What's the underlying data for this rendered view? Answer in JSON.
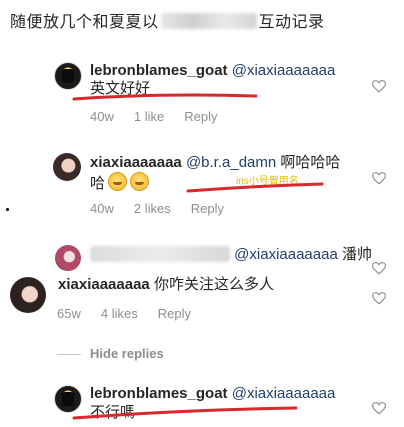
{
  "header": {
    "before": "随便放几个和夏夏以",
    "after": "互动记录"
  },
  "comments": [
    {
      "username": "lebronblames_goat",
      "mention": "@xiaxiaaaaaaa",
      "text": "英文好好",
      "time": "40w",
      "likes": "1 like",
      "reply": "Reply"
    },
    {
      "username": "xiaxiaaaaaaa",
      "mention": "@b.r.a_damn",
      "text": "啊哈哈哈",
      "text2": "哈",
      "annotation": "ins小号曾用名",
      "time": "40w",
      "likes": "2 likes",
      "reply": "Reply"
    },
    {
      "mention": "@xiaxiaaaaaaa",
      "text": "潘帅"
    },
    {
      "username": "xiaxiaaaaaaa",
      "text": "你咋关注这么多人",
      "time": "65w",
      "likes": "4 likes",
      "reply": "Reply"
    },
    {
      "username": "lebronblames_goat",
      "mention": "@xiaxiaaaaaaa",
      "text": "不行嗎"
    }
  ],
  "hide_replies": "Hide replies"
}
